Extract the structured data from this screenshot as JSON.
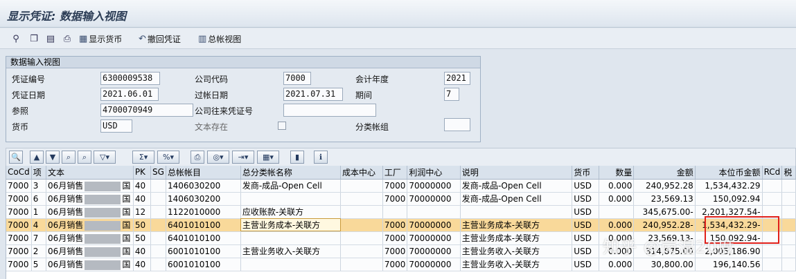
{
  "window": {
    "title": "显示凭证: 数据输入视图"
  },
  "toolbar": {
    "icons": [
      "glasses-icon",
      "copy-icon",
      "document-icon",
      "print-icon"
    ],
    "buttons": [
      {
        "icon": "currency-icon",
        "label": "显示货币"
      },
      {
        "icon": "undo-icon",
        "label": "撤回凭证"
      },
      {
        "icon": "ledger-icon",
        "label": "总帐视图"
      }
    ]
  },
  "header": {
    "group_title": "数据输入视图",
    "fields": {
      "doc_no": {
        "label": "凭证编号",
        "value": "6300009538"
      },
      "company_code": {
        "label": "公司代码",
        "value": "7000"
      },
      "fiscal_year": {
        "label": "会计年度",
        "value": "2021"
      },
      "doc_date": {
        "label": "凭证日期",
        "value": "2021.06.01"
      },
      "posting_date": {
        "label": "过帐日期",
        "value": "2021.07.31"
      },
      "period": {
        "label": "期间",
        "value": "7"
      },
      "reference": {
        "label": "参照",
        "value": "4700070949"
      },
      "intercompany": {
        "label": "公司往来凭证号",
        "value": ""
      },
      "currency": {
        "label": "货币",
        "value": "USD"
      },
      "text_exists": {
        "label": "文本存在",
        "checked": false
      },
      "ledger_group": {
        "label": "分类帐组",
        "value": ""
      }
    }
  },
  "grid": {
    "columns": [
      "CoCd",
      "项",
      "文本",
      "PK",
      "SG",
      "总帐帐目",
      "总分类帐名称",
      "成本中心",
      "工厂",
      "利润中心",
      "说明",
      "货币",
      "数量",
      "金额",
      "本位币金额",
      "RCd",
      "税"
    ],
    "rows": [
      {
        "cocd": "7000",
        "item": "3",
        "text": "06月销售",
        "text2": "国",
        "pk": "40",
        "sg": "",
        "gl": "1406030200",
        "gl_name": "发商-成品-Open Cell",
        "cc": "",
        "plant": "7000",
        "pc": "70000000",
        "desc": "发商-成品-Open Cell",
        "cur": "USD",
        "qty": "0.000",
        "amt": "240,952.28",
        "lc_amt": "1,534,432.29",
        "rcd": "",
        "tax": "",
        "selected": false
      },
      {
        "cocd": "7000",
        "item": "6",
        "text": "06月销售",
        "text2": "国",
        "pk": "40",
        "sg": "",
        "gl": "1406030200",
        "gl_name": "",
        "cc": "",
        "plant": "7000",
        "pc": "70000000",
        "desc": "发商-成品-Open Cell",
        "cur": "USD",
        "qty": "0.000",
        "amt": "23,569.13",
        "lc_amt": "150,092.94",
        "rcd": "",
        "tax": "",
        "selected": false
      },
      {
        "cocd": "7000",
        "item": "1",
        "text": "06月销售",
        "text2": "国",
        "pk": "12",
        "sg": "",
        "gl": "1122010000",
        "gl_name": "应收账款-关联方",
        "cc": "",
        "plant": "",
        "pc": "",
        "desc": "",
        "cur": "USD",
        "qty": "",
        "amt": "345,675.00-",
        "lc_amt": "2,201,327.54-",
        "rcd": "",
        "tax": "",
        "selected": false
      },
      {
        "cocd": "7000",
        "item": "4",
        "text": "06月销售",
        "text2": "国",
        "pk": "50",
        "sg": "",
        "gl": "6401010100",
        "gl_name": "主营业务成本-关联方",
        "cc": "",
        "plant": "7000",
        "pc": "70000000",
        "desc": "主营业务成本-关联方",
        "cur": "USD",
        "qty": "0.000",
        "amt": "240,952.28-",
        "lc_amt": "1,534,432.29-",
        "rcd": "",
        "tax": "",
        "selected": true
      },
      {
        "cocd": "7000",
        "item": "7",
        "text": "06月销售",
        "text2": "国",
        "pk": "50",
        "sg": "",
        "gl": "6401010100",
        "gl_name": "",
        "cc": "",
        "plant": "7000",
        "pc": "70000000",
        "desc": "主营业务成本-关联方",
        "cur": "USD",
        "qty": "0.000",
        "amt": "23,569.13-",
        "lc_amt": "150,092.94-",
        "rcd": "",
        "tax": "",
        "selected": false
      },
      {
        "cocd": "7000",
        "item": "2",
        "text": "06月销售",
        "text2": "国",
        "pk": "40",
        "sg": "",
        "gl": "6001010100",
        "gl_name": "主营业务收入-关联方",
        "cc": "",
        "plant": "7000",
        "pc": "70000000",
        "desc": "主营业务收入-关联方",
        "cur": "USD",
        "qty": "0.000",
        "amt": "314,875.00",
        "lc_amt": "2,005,186.90",
        "rcd": "",
        "tax": "",
        "selected": false
      },
      {
        "cocd": "7000",
        "item": "5",
        "text": "06月销售",
        "text2": "国",
        "pk": "40",
        "sg": "",
        "gl": "6001010100",
        "gl_name": "",
        "cc": "",
        "plant": "7000",
        "pc": "70000000",
        "desc": "主营业务收入-关联方",
        "cur": "USD",
        "qty": "0.000",
        "amt": "30,800.00",
        "lc_amt": "196,140.56",
        "rcd": "",
        "tax": "",
        "selected": false
      }
    ]
  },
  "watermark": "知乎 @岗湿20度"
}
